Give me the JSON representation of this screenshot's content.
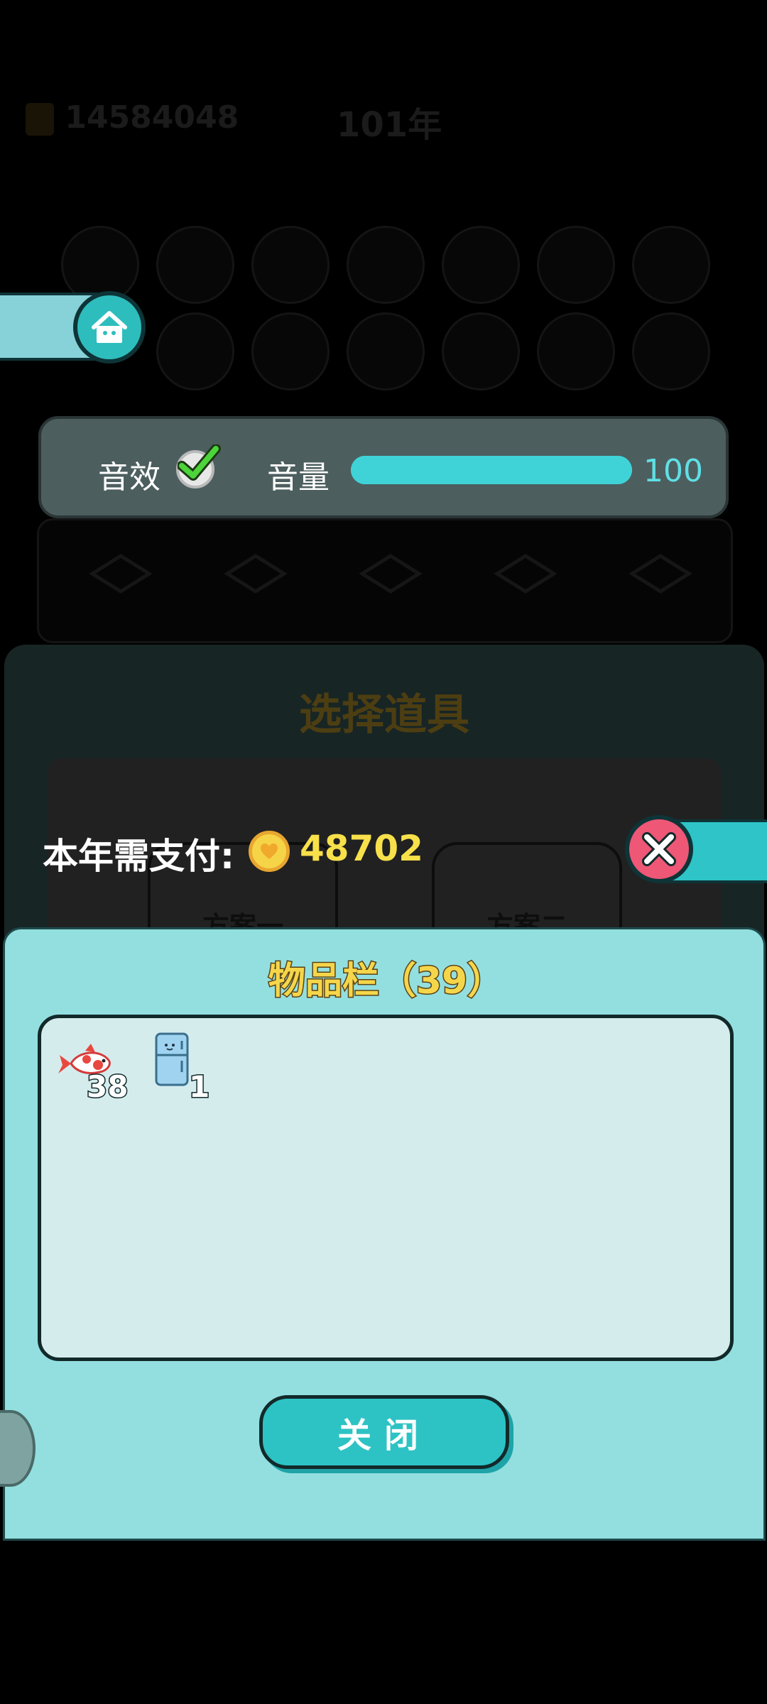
{
  "background": {
    "money_text": "14584048",
    "year_text": "101年",
    "dialog_title": "选择道具",
    "plan_one": "方案一",
    "plan_two": "方案二"
  },
  "settings": {
    "sound_label": "音效",
    "sound_enabled": true,
    "volume_label": "音量",
    "volume_value": "100",
    "volume_fraction": 1.0
  },
  "payment": {
    "label": "本年需支付:",
    "amount": "48702"
  },
  "inventory": {
    "title": "物品栏（39）",
    "items": [
      {
        "icon": "koi-fish-icon",
        "count": "38"
      },
      {
        "icon": "refrigerator-icon",
        "count": "1"
      }
    ],
    "close_label": "关闭"
  },
  "colors": {
    "accent": "#2ec4c8",
    "panel": "#93dfe0",
    "coin": "#f6d447",
    "close_red": "#ee5776"
  }
}
